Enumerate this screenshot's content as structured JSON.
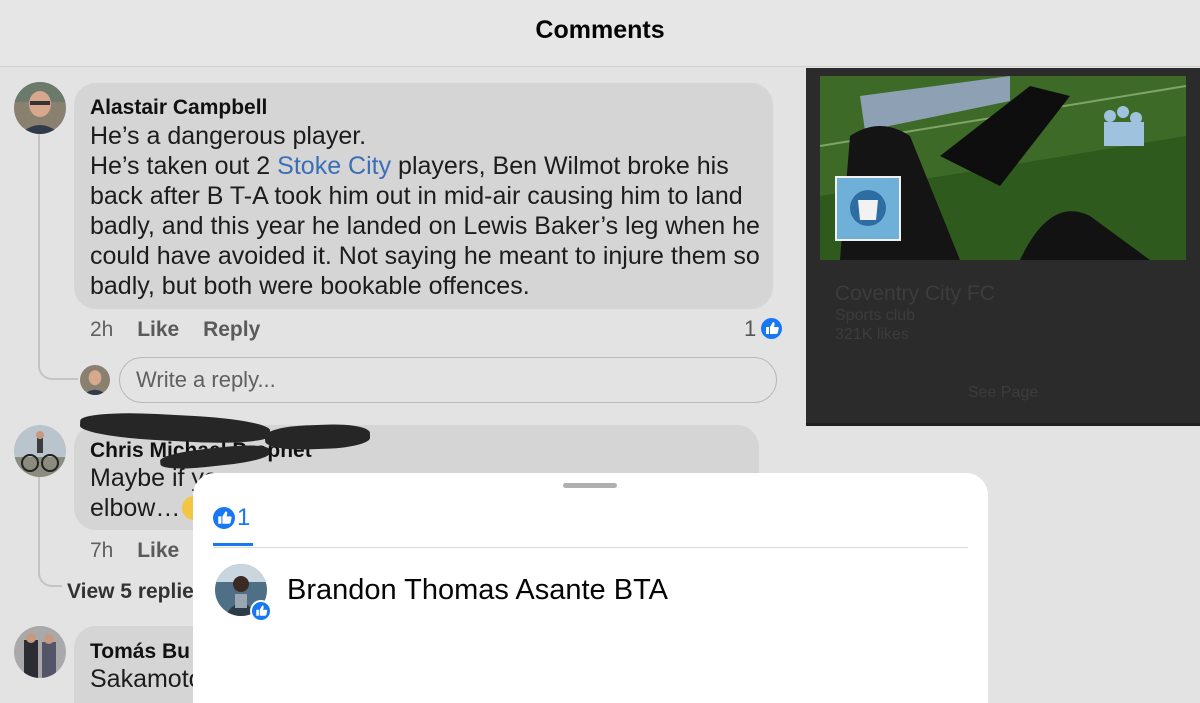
{
  "header": {
    "title": "Comments"
  },
  "comments": [
    {
      "author": "Alastair Campbell",
      "lines": [
        "He’s a dangerous player.",
        "He’s taken out 2 ",
        "back after B T-A took him out in mid-air causing him to land",
        "badly, and this year he landed on Lewis Baker’s leg when he",
        "could have avoided it. Not saying he meant to injure them so",
        "badly, but both were bookable offences."
      ],
      "mention": "Stoke City",
      "mention_after": " players, Ben Wilmot broke his",
      "time": "2h",
      "like_label": "Like",
      "reply_label": "Reply",
      "like_count": "1"
    },
    {
      "author": "Chris Michael Prophet",
      "lines": [
        "Maybe if yo",
        "elbow…"
      ],
      "time": "7h",
      "like_label": "Like",
      "view_replies": "View 5 replie"
    },
    {
      "author": "Tomás Bu",
      "lines": [
        "Sakamoto"
      ]
    }
  ],
  "reply_box": {
    "placeholder": "Write a reply..."
  },
  "page_card": {
    "name": "Coventry City FC",
    "category": "Sports club",
    "likes": "321K likes",
    "see_page": "See Page"
  },
  "reactions_sheet": {
    "all_count": "1",
    "reactors": [
      {
        "name": "Brandon Thomas Asante BTA",
        "reaction": "like"
      }
    ]
  },
  "colors": {
    "accent": "#1877f2",
    "mention": "#3a6fb8",
    "bubble": "#d5d5d5"
  },
  "icons": {
    "like": "thumbs-up-icon",
    "emoji": "thinking-face-icon"
  }
}
